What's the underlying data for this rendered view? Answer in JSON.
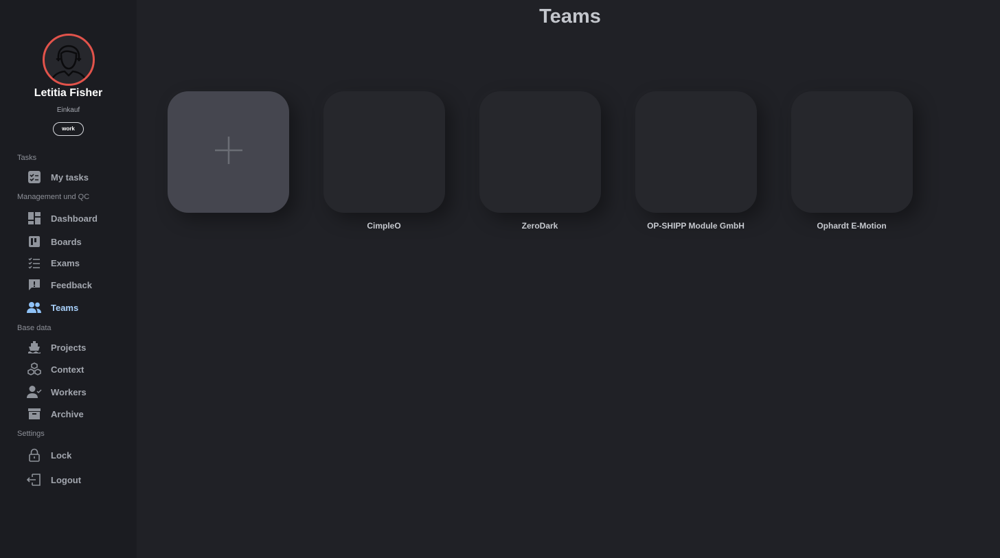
{
  "user": {
    "name": "Letitia Fisher",
    "department": "Einkauf",
    "tag": "work"
  },
  "sidebar": {
    "sections": {
      "tasks": "Tasks",
      "management": "Management und QC",
      "base_data": "Base data",
      "settings": "Settings"
    },
    "items": {
      "my_tasks": "My tasks",
      "dashboard": "Dashboard",
      "boards": "Boards",
      "exams": "Exams",
      "feedback": "Feedback",
      "teams": "Teams",
      "projects": "Projects",
      "context": "Context",
      "workers": "Workers",
      "archive": "Archive",
      "lock": "Lock",
      "logout": "Logout"
    },
    "active_item": "teams"
  },
  "main": {
    "title": "Teams",
    "teams": [
      "CimpleO",
      "ZeroDark",
      "OP-SHIPP Module GmbH",
      "Ophardt E-Motion"
    ]
  },
  "icons": {
    "avatar": "user-avatar-icon",
    "add": "plus-icon"
  },
  "colors": {
    "accent": "#8fc2f7",
    "avatar_ring": "#e2534b",
    "background": "#202126",
    "sidebar": "#1b1c21"
  }
}
